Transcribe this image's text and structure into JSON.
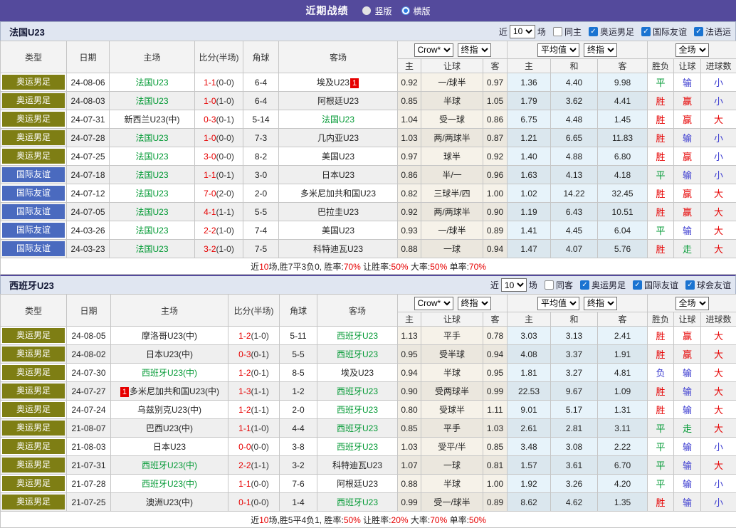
{
  "title_bar": {
    "title": "近期战绩",
    "view_options": [
      {
        "label": "竖版",
        "selected": false
      },
      {
        "label": "横版",
        "selected": true
      }
    ]
  },
  "colors": {
    "header_purple": "#544a9c",
    "type_olympic_olive": "#7e7e14",
    "type_friendly_blue": "#4a6abf",
    "focus_team_green": "#009933",
    "win_red": "#e60000",
    "lose_blue": "#3c3cd0"
  },
  "table_header": {
    "left_cols": [
      "类型",
      "日期",
      "主场",
      "比分(半场)",
      "角球",
      "客场"
    ],
    "odds_selects": [
      "Crow*",
      "终指"
    ],
    "avg_selects": [
      "平均值",
      "终指"
    ],
    "result_selects": [
      "全场"
    ],
    "sub_cols": [
      "主",
      "让球",
      "客",
      "主",
      "和",
      "客",
      "胜负",
      "让球",
      "进球数"
    ]
  },
  "sections": [
    {
      "team": "法国U23",
      "filter": {
        "near": "近",
        "count": "10",
        "matches": "场",
        "same": {
          "label": "同主",
          "checked": false
        },
        "comps": [
          {
            "label": "奥运男足",
            "checked": true
          },
          {
            "label": "国际友谊",
            "checked": true
          },
          {
            "label": "法语运",
            "checked": true
          }
        ]
      },
      "rows": [
        {
          "type": "奥运男足",
          "type_style": "olympic",
          "date": "24-08-06",
          "home": "法国U23",
          "home_focus": true,
          "score": "1-1",
          "half": "(0-0)",
          "corner": "6-4",
          "away": "埃及U23",
          "away_focus": false,
          "away_badge": "1",
          "odds": [
            "0.92",
            "一/球半",
            "0.97"
          ],
          "avg": [
            "1.36",
            "4.40",
            "9.98"
          ],
          "results": [
            [
              "平",
              "g"
            ],
            [
              "输",
              "b"
            ],
            [
              "小",
              "b"
            ]
          ]
        },
        {
          "type": "奥运男足",
          "type_style": "olympic",
          "date": "24-08-03",
          "home": "法国U23",
          "home_focus": true,
          "score": "1-0",
          "half": "(1-0)",
          "corner": "6-4",
          "away": "阿根廷U23",
          "away_focus": false,
          "odds": [
            "0.85",
            "半球",
            "1.05"
          ],
          "avg": [
            "1.79",
            "3.62",
            "4.41"
          ],
          "results": [
            [
              "胜",
              "r"
            ],
            [
              "赢",
              "r"
            ],
            [
              "小",
              "b"
            ]
          ]
        },
        {
          "type": "奥运男足",
          "type_style": "olympic",
          "date": "24-07-31",
          "home": "新西兰U23(中)",
          "home_focus": false,
          "score": "0-3",
          "half": "(0-1)",
          "corner": "5-14",
          "away": "法国U23",
          "away_focus": true,
          "odds": [
            "1.04",
            "受一球",
            "0.86"
          ],
          "avg": [
            "6.75",
            "4.48",
            "1.45"
          ],
          "results": [
            [
              "胜",
              "r"
            ],
            [
              "赢",
              "r"
            ],
            [
              "大",
              "r"
            ]
          ]
        },
        {
          "type": "奥运男足",
          "type_style": "olympic",
          "date": "24-07-28",
          "home": "法国U23",
          "home_focus": true,
          "score": "1-0",
          "half": "(0-0)",
          "corner": "7-3",
          "away": "几内亚U23",
          "away_focus": false,
          "odds": [
            "1.03",
            "两/两球半",
            "0.87"
          ],
          "avg": [
            "1.21",
            "6.65",
            "11.83"
          ],
          "results": [
            [
              "胜",
              "r"
            ],
            [
              "输",
              "b"
            ],
            [
              "小",
              "b"
            ]
          ]
        },
        {
          "type": "奥运男足",
          "type_style": "olympic",
          "date": "24-07-25",
          "home": "法国U23",
          "home_focus": true,
          "score": "3-0",
          "half": "(0-0)",
          "corner": "8-2",
          "away": "美国U23",
          "away_focus": false,
          "odds": [
            "0.97",
            "球半",
            "0.92"
          ],
          "avg": [
            "1.40",
            "4.88",
            "6.80"
          ],
          "results": [
            [
              "胜",
              "r"
            ],
            [
              "赢",
              "r"
            ],
            [
              "小",
              "b"
            ]
          ]
        },
        {
          "type": "国际友谊",
          "type_style": "friendly",
          "date": "24-07-18",
          "home": "法国U23",
          "home_focus": true,
          "score": "1-1",
          "half": "(0-1)",
          "corner": "3-0",
          "away": "日本U23",
          "away_focus": false,
          "odds": [
            "0.86",
            "半/一",
            "0.96"
          ],
          "avg": [
            "1.63",
            "4.13",
            "4.18"
          ],
          "results": [
            [
              "平",
              "g"
            ],
            [
              "输",
              "b"
            ],
            [
              "小",
              "b"
            ]
          ]
        },
        {
          "type": "国际友谊",
          "type_style": "friendly",
          "date": "24-07-12",
          "home": "法国U23",
          "home_focus": true,
          "score": "7-0",
          "half": "(2-0)",
          "corner": "2-0",
          "away": "多米尼加共和国U23",
          "away_focus": false,
          "odds": [
            "0.82",
            "三球半/四",
            "1.00"
          ],
          "avg": [
            "1.02",
            "14.22",
            "32.45"
          ],
          "results": [
            [
              "胜",
              "r"
            ],
            [
              "赢",
              "r"
            ],
            [
              "大",
              "r"
            ]
          ]
        },
        {
          "type": "国际友谊",
          "type_style": "friendly",
          "date": "24-07-05",
          "home": "法国U23",
          "home_focus": true,
          "score": "4-1",
          "half": "(1-1)",
          "corner": "5-5",
          "away": "巴拉圭U23",
          "away_focus": false,
          "odds": [
            "0.92",
            "两/两球半",
            "0.90"
          ],
          "avg": [
            "1.19",
            "6.43",
            "10.51"
          ],
          "results": [
            [
              "胜",
              "r"
            ],
            [
              "赢",
              "r"
            ],
            [
              "大",
              "r"
            ]
          ]
        },
        {
          "type": "国际友谊",
          "type_style": "friendly",
          "date": "24-03-26",
          "home": "法国U23",
          "home_focus": true,
          "score": "2-2",
          "half": "(1-0)",
          "corner": "7-4",
          "away": "美国U23",
          "away_focus": false,
          "odds": [
            "0.93",
            "一/球半",
            "0.89"
          ],
          "avg": [
            "1.41",
            "4.45",
            "6.04"
          ],
          "results": [
            [
              "平",
              "g"
            ],
            [
              "输",
              "b"
            ],
            [
              "大",
              "r"
            ]
          ]
        },
        {
          "type": "国际友谊",
          "type_style": "friendly",
          "date": "24-03-23",
          "home": "法国U23",
          "home_focus": true,
          "score": "3-2",
          "half": "(1-0)",
          "corner": "7-5",
          "away": "科特迪瓦U23",
          "away_focus": false,
          "odds": [
            "0.88",
            "一球",
            "0.94"
          ],
          "avg": [
            "1.47",
            "4.07",
            "5.76"
          ],
          "results": [
            [
              "胜",
              "r"
            ],
            [
              "走",
              "g"
            ],
            [
              "大",
              "r"
            ]
          ]
        }
      ],
      "summary": [
        [
          "近",
          "k"
        ],
        [
          "10",
          "r"
        ],
        [
          "场,胜7平3负0, 胜率:",
          "k"
        ],
        [
          "70%",
          "r"
        ],
        [
          " 让胜率:",
          "k"
        ],
        [
          "50%",
          "r"
        ],
        [
          " 大率:",
          "k"
        ],
        [
          "50%",
          "r"
        ],
        [
          " 单率:",
          "k"
        ],
        [
          "70%",
          "r"
        ]
      ]
    },
    {
      "team": "西班牙U23",
      "filter": {
        "near": "近",
        "count": "10",
        "matches": "场",
        "same": {
          "label": "同客",
          "checked": false
        },
        "comps": [
          {
            "label": "奥运男足",
            "checked": true
          },
          {
            "label": "国际友谊",
            "checked": true
          },
          {
            "label": "球会友谊",
            "checked": true
          }
        ]
      },
      "rows": [
        {
          "type": "奥运男足",
          "type_style": "olympic",
          "date": "24-08-05",
          "home": "摩洛哥U23(中)",
          "home_focus": false,
          "score": "1-2",
          "half": "(1-0)",
          "corner": "5-11",
          "away": "西班牙U23",
          "away_focus": true,
          "odds": [
            "1.13",
            "平手",
            "0.78"
          ],
          "avg": [
            "3.03",
            "3.13",
            "2.41"
          ],
          "results": [
            [
              "胜",
              "r"
            ],
            [
              "赢",
              "r"
            ],
            [
              "大",
              "r"
            ]
          ]
        },
        {
          "type": "奥运男足",
          "type_style": "olympic",
          "date": "24-08-02",
          "home": "日本U23(中)",
          "home_focus": false,
          "score": "0-3",
          "half": "(0-1)",
          "corner": "5-5",
          "away": "西班牙U23",
          "away_focus": true,
          "odds": [
            "0.95",
            "受半球",
            "0.94"
          ],
          "avg": [
            "4.08",
            "3.37",
            "1.91"
          ],
          "results": [
            [
              "胜",
              "r"
            ],
            [
              "赢",
              "r"
            ],
            [
              "大",
              "r"
            ]
          ]
        },
        {
          "type": "奥运男足",
          "type_style": "olympic",
          "date": "24-07-30",
          "home": "西班牙U23(中)",
          "home_focus": true,
          "score": "1-2",
          "half": "(0-1)",
          "corner": "8-5",
          "away": "埃及U23",
          "away_focus": false,
          "odds": [
            "0.94",
            "半球",
            "0.95"
          ],
          "avg": [
            "1.81",
            "3.27",
            "4.81"
          ],
          "results": [
            [
              "负",
              "b"
            ],
            [
              "输",
              "b"
            ],
            [
              "大",
              "r"
            ]
          ]
        },
        {
          "type": "奥运男足",
          "type_style": "olympic",
          "date": "24-07-27",
          "home": "多米尼加共和国U23(中)",
          "home_focus": false,
          "home_badge": "1",
          "score": "1-3",
          "half": "(1-1)",
          "corner": "1-2",
          "away": "西班牙U23",
          "away_focus": true,
          "odds": [
            "0.90",
            "受两球半",
            "0.99"
          ],
          "avg": [
            "22.53",
            "9.67",
            "1.09"
          ],
          "results": [
            [
              "胜",
              "r"
            ],
            [
              "输",
              "b"
            ],
            [
              "大",
              "r"
            ]
          ]
        },
        {
          "type": "奥运男足",
          "type_style": "olympic",
          "date": "24-07-24",
          "home": "乌兹别克U23(中)",
          "home_focus": false,
          "score": "1-2",
          "half": "(1-1)",
          "corner": "2-0",
          "away": "西班牙U23",
          "away_focus": true,
          "odds": [
            "0.80",
            "受球半",
            "1.11"
          ],
          "avg": [
            "9.01",
            "5.17",
            "1.31"
          ],
          "results": [
            [
              "胜",
              "r"
            ],
            [
              "输",
              "b"
            ],
            [
              "大",
              "r"
            ]
          ]
        },
        {
          "type": "奥运男足",
          "type_style": "olympic",
          "date": "21-08-07",
          "home": "巴西U23(中)",
          "home_focus": false,
          "score": "1-1",
          "half": "(1-0)",
          "corner": "4-4",
          "away": "西班牙U23",
          "away_focus": true,
          "odds": [
            "0.85",
            "平手",
            "1.03"
          ],
          "avg": [
            "2.61",
            "2.81",
            "3.11"
          ],
          "results": [
            [
              "平",
              "g"
            ],
            [
              "走",
              "g"
            ],
            [
              "大",
              "r"
            ]
          ]
        },
        {
          "type": "奥运男足",
          "type_style": "olympic",
          "date": "21-08-03",
          "home": "日本U23",
          "home_focus": false,
          "score": "0-0",
          "half": "(0-0)",
          "corner": "3-8",
          "away": "西班牙U23",
          "away_focus": true,
          "odds": [
            "1.03",
            "受平/半",
            "0.85"
          ],
          "avg": [
            "3.48",
            "3.08",
            "2.22"
          ],
          "results": [
            [
              "平",
              "g"
            ],
            [
              "输",
              "b"
            ],
            [
              "小",
              "b"
            ]
          ]
        },
        {
          "type": "奥运男足",
          "type_style": "olympic",
          "date": "21-07-31",
          "home": "西班牙U23(中)",
          "home_focus": true,
          "score": "2-2",
          "half": "(1-1)",
          "corner": "3-2",
          "away": "科特迪瓦U23",
          "away_focus": false,
          "odds": [
            "1.07",
            "一球",
            "0.81"
          ],
          "avg": [
            "1.57",
            "3.61",
            "6.70"
          ],
          "results": [
            [
              "平",
              "g"
            ],
            [
              "输",
              "b"
            ],
            [
              "大",
              "r"
            ]
          ]
        },
        {
          "type": "奥运男足",
          "type_style": "olympic",
          "date": "21-07-28",
          "home": "西班牙U23(中)",
          "home_focus": true,
          "score": "1-1",
          "half": "(0-0)",
          "corner": "7-6",
          "away": "阿根廷U23",
          "away_focus": false,
          "odds": [
            "0.88",
            "半球",
            "1.00"
          ],
          "avg": [
            "1.92",
            "3.26",
            "4.20"
          ],
          "results": [
            [
              "平",
              "g"
            ],
            [
              "输",
              "b"
            ],
            [
              "小",
              "b"
            ]
          ]
        },
        {
          "type": "奥运男足",
          "type_style": "olympic",
          "date": "21-07-25",
          "home": "澳洲U23(中)",
          "home_focus": false,
          "score": "0-1",
          "half": "(0-0)",
          "corner": "1-4",
          "away": "西班牙U23",
          "away_focus": true,
          "odds": [
            "0.99",
            "受一/球半",
            "0.89"
          ],
          "avg": [
            "8.62",
            "4.62",
            "1.35"
          ],
          "results": [
            [
              "胜",
              "r"
            ],
            [
              "输",
              "b"
            ],
            [
              "小",
              "b"
            ]
          ]
        }
      ],
      "summary": [
        [
          "近",
          "k"
        ],
        [
          "10",
          "r"
        ],
        [
          "场,胜5平4负1, 胜率:",
          "k"
        ],
        [
          "50%",
          "r"
        ],
        [
          " 让胜率:",
          "k"
        ],
        [
          "20%",
          "r"
        ],
        [
          " 大率:",
          "k"
        ],
        [
          "70%",
          "r"
        ],
        [
          " 单率:",
          "k"
        ],
        [
          "50%",
          "r"
        ]
      ]
    }
  ]
}
